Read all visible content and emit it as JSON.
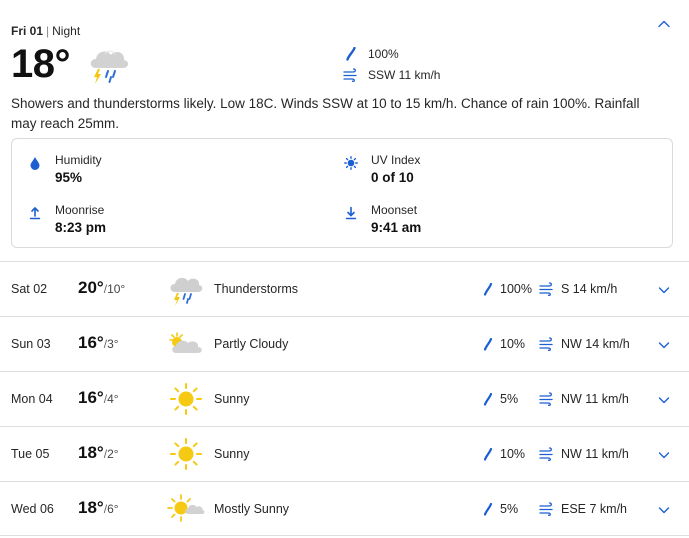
{
  "today": {
    "day": "Fri 01",
    "period": "Night",
    "temp": "18°",
    "icon": "thunderstorm-icon",
    "rain_chance": "100%",
    "wind": "SSW 11 km/h",
    "summary": "Showers and thunderstorms likely. Low 18C. Winds SSW at 10 to 15 km/h. Chance of rain 100%. Rainfall may reach 25mm.",
    "details": {
      "humidity_label": "Humidity",
      "humidity_value": "95%",
      "uv_label": "UV Index",
      "uv_value": "0 of 10",
      "moonrise_label": "Moonrise",
      "moonrise_value": "8:23 pm",
      "moonset_label": "Moonset",
      "moonset_value": "9:41 am"
    }
  },
  "days": [
    {
      "day": "Sat 02",
      "hi": "20°",
      "lo": "10°",
      "icon": "thunderstorm-icon",
      "condition": "Thunderstorms",
      "rain": "100%",
      "wind": "S 14 km/h"
    },
    {
      "day": "Sun 03",
      "hi": "16°",
      "lo": "3°",
      "icon": "partly-cloudy-icon",
      "condition": "Partly Cloudy",
      "rain": "10%",
      "wind": "NW 14 km/h"
    },
    {
      "day": "Mon 04",
      "hi": "16°",
      "lo": "4°",
      "icon": "sunny-icon",
      "condition": "Sunny",
      "rain": "5%",
      "wind": "NW 11 km/h"
    },
    {
      "day": "Tue 05",
      "hi": "18°",
      "lo": "2°",
      "icon": "sunny-icon",
      "condition": "Sunny",
      "rain": "10%",
      "wind": "NW 11 km/h"
    },
    {
      "day": "Wed 06",
      "hi": "18°",
      "lo": "6°",
      "icon": "mostly-sunny-icon",
      "condition": "Mostly Sunny",
      "rain": "5%",
      "wind": "ESE 7 km/h"
    }
  ],
  "colors": {
    "accent": "#1b5fd1",
    "sun": "#f6c913",
    "cloud": "#c9c9c9",
    "border": "#dedede"
  }
}
